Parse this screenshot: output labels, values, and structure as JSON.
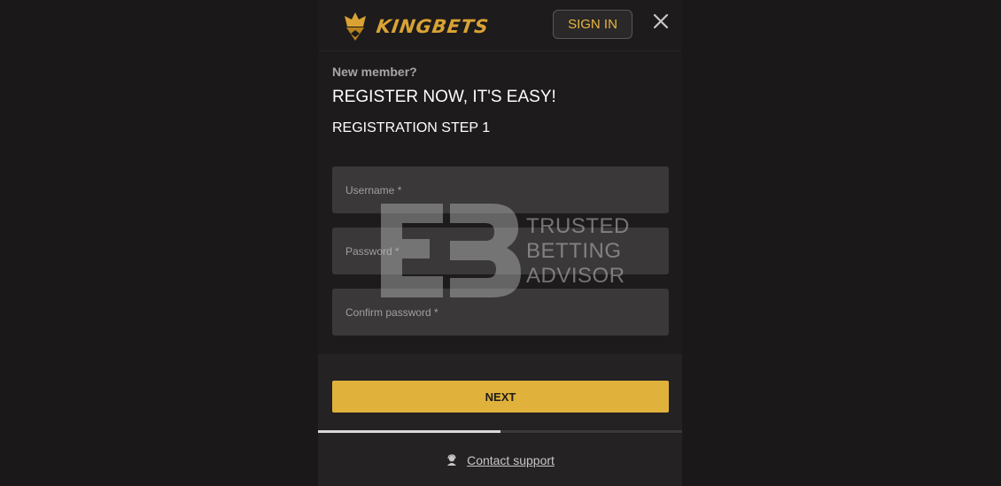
{
  "header": {
    "brand": "KINGBETS",
    "sign_in_label": "SIGN IN",
    "close_icon": "close-icon"
  },
  "intro": {
    "new_member": "New member?",
    "title": "REGISTER NOW, IT'S EASY!",
    "step": "REGISTRATION STEP 1"
  },
  "form": {
    "fields": [
      {
        "placeholder": "Username *"
      },
      {
        "placeholder": "Password *"
      },
      {
        "placeholder": "Confirm password *"
      }
    ],
    "next_label": "NEXT",
    "progress": 0.5
  },
  "footer": {
    "support_label": "Contact support",
    "support_icon": "support-agent-icon"
  },
  "watermark": {
    "lines": [
      "TRUSTED",
      "BETTING",
      "ADVISOR"
    ]
  },
  "colors": {
    "accent": "#e0b23c",
    "background": "#1a1819",
    "field": "#3a3839"
  }
}
